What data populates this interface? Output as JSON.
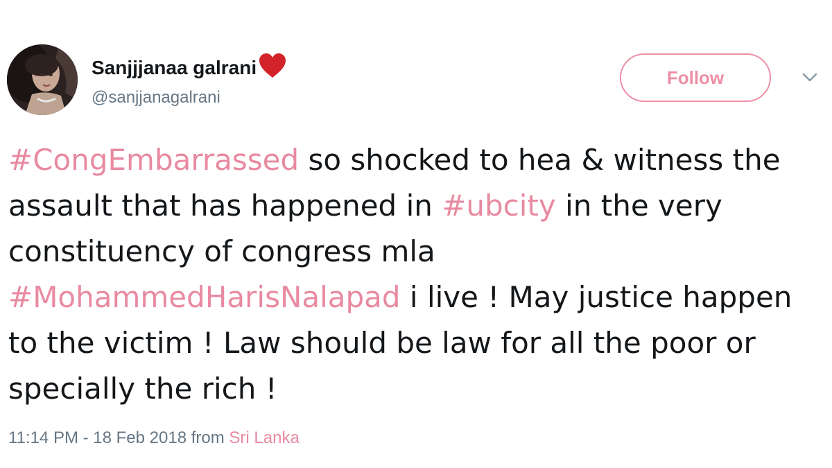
{
  "author": {
    "display_name": "Sanjjjanaa galrani",
    "username": "@sanjjanagalrani",
    "heart_color": "#d2232a"
  },
  "actions": {
    "follow_label": "Follow",
    "accent_color": "#ec8fa5"
  },
  "tweet": {
    "segments": [
      {
        "type": "hashtag",
        "text": "#CongEmbarrassed"
      },
      {
        "type": "text",
        "text": " so shocked to hea & witness the assault that has happened in "
      },
      {
        "type": "hashtag",
        "text": "#ubcity"
      },
      {
        "type": "text",
        "text": " in the very constituency of congress mla "
      },
      {
        "type": "hashtag",
        "text": "#MohammedHarisNalapad"
      },
      {
        "type": "text",
        "text": " i live ! May justice happen to the victim ! Law should be law for all the poor or specially the rich !"
      }
    ]
  },
  "meta": {
    "timestamp": "11:14 PM - 18 Feb 2018",
    "from_label": "from",
    "location": "Sri Lanka"
  }
}
